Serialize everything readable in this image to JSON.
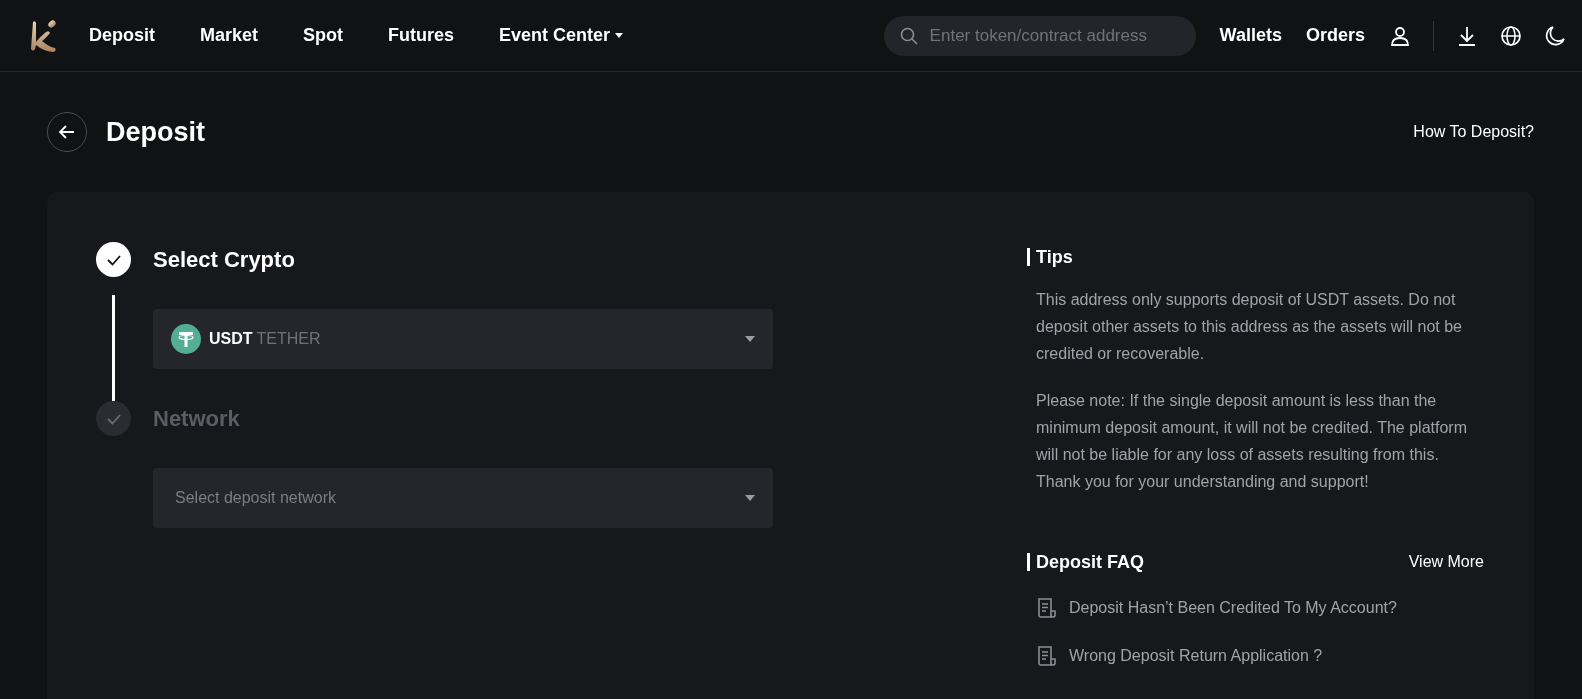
{
  "nav": {
    "items": [
      {
        "label": "Deposit",
        "dropdown": false
      },
      {
        "label": "Market",
        "dropdown": false
      },
      {
        "label": "Spot",
        "dropdown": false
      },
      {
        "label": "Futures",
        "dropdown": false
      },
      {
        "label": "Event Center",
        "dropdown": true
      }
    ],
    "search": {
      "placeholder": "Enter token/contract address"
    },
    "links": [
      "Wallets",
      "Orders"
    ]
  },
  "page": {
    "title": "Deposit",
    "help_link": "How To Deposit?"
  },
  "steps": [
    {
      "title": "Select Crypto",
      "active": true,
      "select": {
        "symbol": "USDT",
        "name": "TETHER"
      }
    },
    {
      "title": "Network",
      "active": false,
      "select": {
        "placeholder": "Select deposit network"
      }
    }
  ],
  "tips": {
    "title": "Tips",
    "paragraphs": [
      "This address only supports deposit of USDT assets. Do not deposit other assets to this address as the assets will not be credited or recoverable.",
      "Please note: If the single deposit amount is less than the minimum deposit amount, it will not be credited. The platform will not be liable for any loss of assets resulting from this. Thank you for your understanding and support!"
    ]
  },
  "faq": {
    "title": "Deposit FAQ",
    "more": "View More",
    "items": [
      "Deposit Hasn’t Been Credited To My Account?",
      "Wrong Deposit Return Application ?"
    ]
  }
}
